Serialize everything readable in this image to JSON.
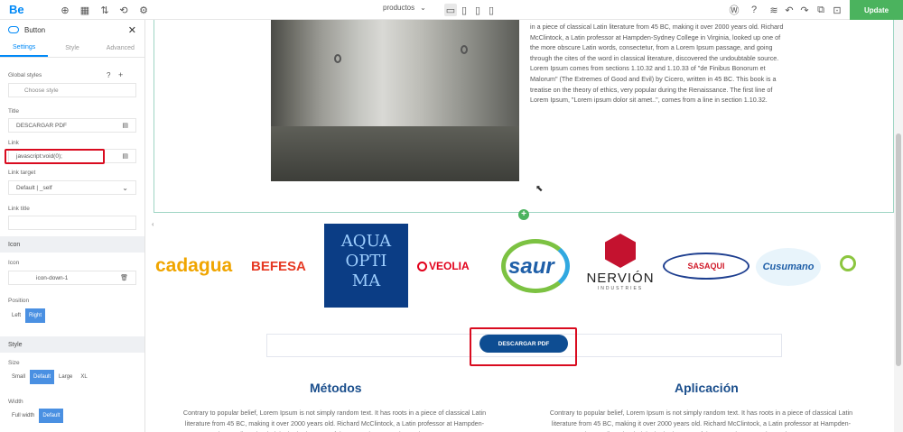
{
  "topbar": {
    "logo": "Be",
    "page_select": "productos",
    "update_label": "Update"
  },
  "sidebar": {
    "title": "Button",
    "tabs": [
      "Settings",
      "Style",
      "Advanced"
    ],
    "global_styles_label": "Global styles",
    "global_styles_placeholder": "Choose style",
    "title_label": "Title",
    "title_value": "DESCARGAR PDF",
    "link_label": "Link",
    "link_value": "javascript:void(0);",
    "link_target_label": "Link target",
    "link_target_value": "Default | _self",
    "link_title_label": "Link title",
    "icon_section": "Icon",
    "icon_label": "Icon",
    "icon_value": "icon-down-1",
    "position_label": "Position",
    "position_options": [
      "Left",
      "Right"
    ],
    "style_section": "Style",
    "size_label": "Size",
    "size_options": [
      "Small",
      "Default",
      "Large",
      "XL"
    ],
    "width_label": "Width",
    "width_options": [
      "Full width",
      "Default"
    ]
  },
  "canvas": {
    "lorem_text": "in a piece of classical Latin literature from 45 BC, making it over 2000 years old. Richard McClintock, a Latin professor at Hampden-Sydney College in Virginia, looked up one of the more obscure Latin words, consectetur, from a Lorem Ipsum passage, and going through the cites of the word in classical literature, discovered the undoubtable source. Lorem Ipsum comes from sections 1.10.32 and 1.10.33 of \"de Finibus Bonorum et Malorum\" (The Extremes of Good and Evil) by Cicero, written in 45 BC. This book is a treatise on the theory of ethics, very popular during the Renaissance. The first line of Lorem Ipsum, \"Lorem ipsum dolor sit amet..\", comes from a line in section 1.10.32.",
    "logos": {
      "cadagua": "cadagua",
      "befesa": "BEFESA",
      "aquaoptima": [
        "AQUA",
        "OPTI",
        "MA"
      ],
      "veolia": "VEOLIA",
      "saur": "saur",
      "nervion": "NERVIÓN",
      "nervion_sub": "INDUSTRIES",
      "sasaqui": "SASAQUI",
      "cusumano": "Cusumano"
    },
    "download_button": "DESCARGAR PDF",
    "heading_left": "Métodos",
    "heading_right": "Aplicación",
    "para_left": "Contrary to popular belief, Lorem Ipsum is not simply random text. It has roots in a piece of classical Latin literature from 45 BC, making it over 2000 years old. Richard McClintock, a Latin professor at Hampden-Sydney College in Virginia, looked up one of the more obscure Latin words, consectetur",
    "para_right": "Contrary to popular belief, Lorem Ipsum is not simply random text. It has roots in a piece of classical Latin literature from 45 BC, making it over 2000 years old. Richard McClintock, a Latin professor at Hampden-Sydney College in Virginia, looked up one of the more obscure Latin words, consectetur"
  }
}
